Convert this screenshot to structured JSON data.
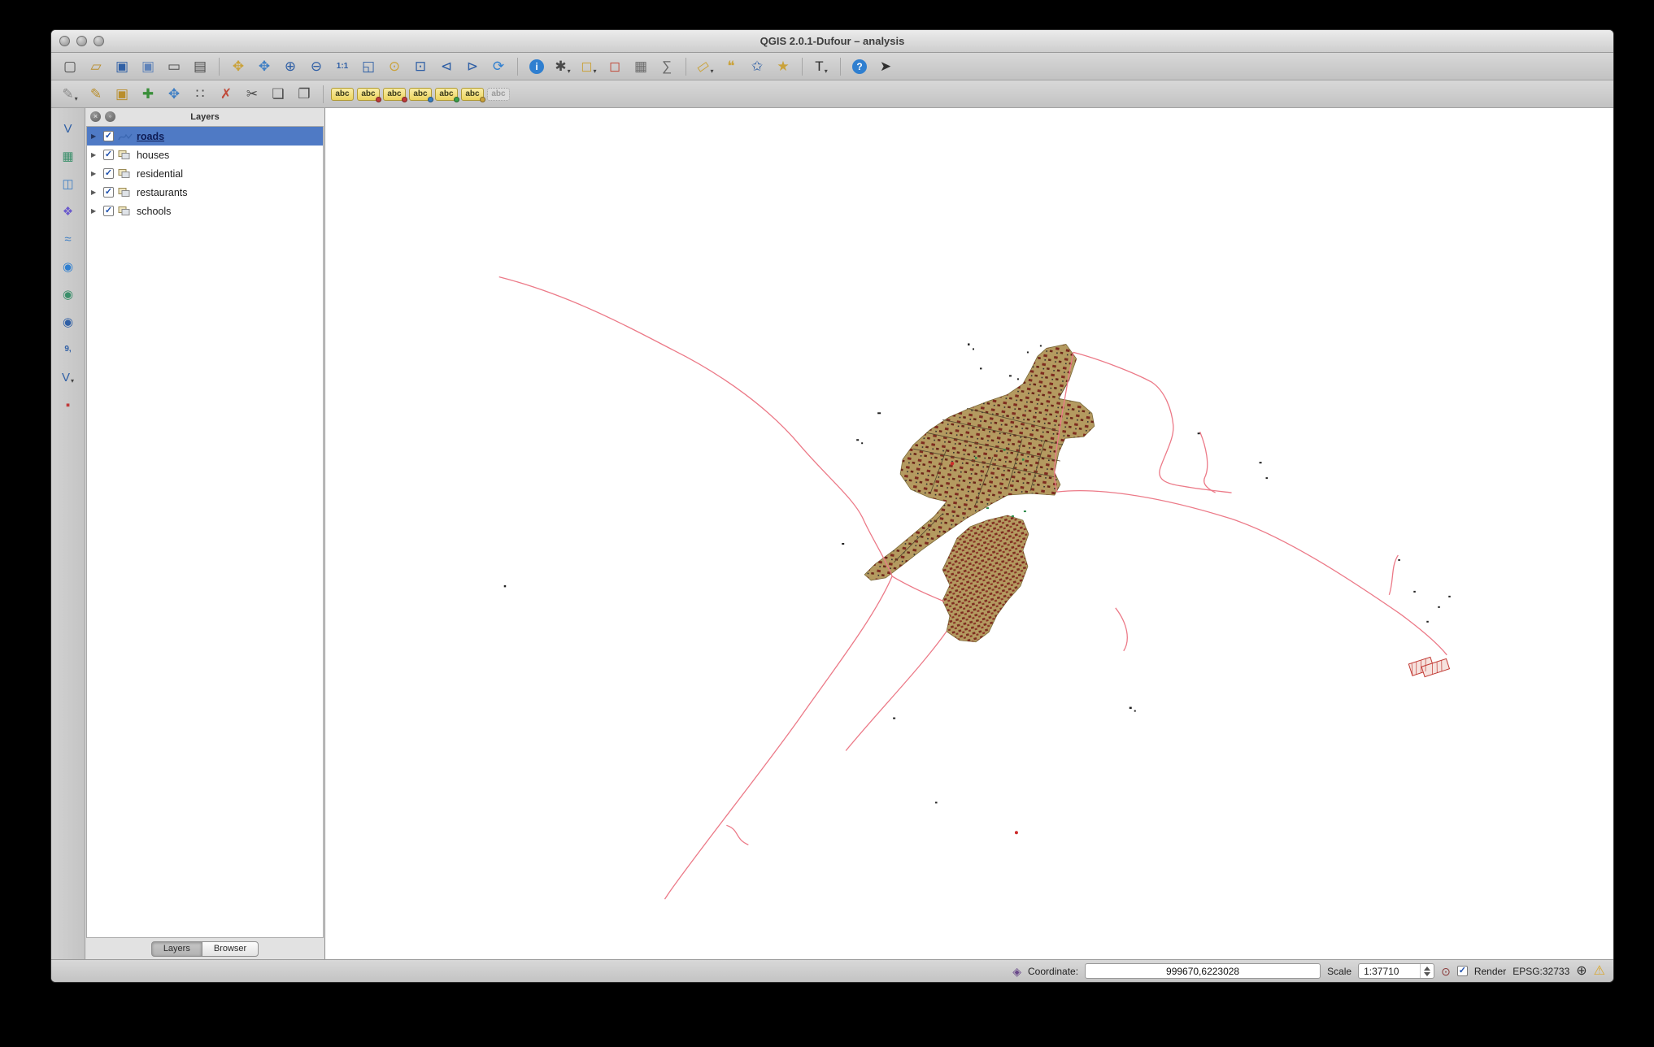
{
  "window": {
    "title": "QGIS 2.0.1-Dufour – analysis"
  },
  "misc": {
    "abc_text": "abc",
    "expand_arrow": "▶",
    "check_glyph": "✓",
    "dropdown_arrow": "▾"
  },
  "colors": {
    "road_line": "#ec7a88",
    "urban_fill": "#b49a60",
    "building": "#7d2b1f",
    "selection_blue": "#4f7ac5"
  },
  "toolbar_row1": [
    {
      "name": "new-project",
      "glyph": "▢",
      "color": "#4a4a4a"
    },
    {
      "name": "open-project",
      "glyph": "▱",
      "color": "#b98e2c"
    },
    {
      "name": "save-project",
      "glyph": "▣",
      "color": "#2f5fa5"
    },
    {
      "name": "save-project-as",
      "glyph": "▣",
      "color": "#5f83b9"
    },
    {
      "name": "new-print-composer",
      "glyph": "▭",
      "color": "#4a4a4a"
    },
    {
      "name": "composer-manager",
      "glyph": "▤",
      "color": "#4a4a4a"
    },
    {
      "sep": true
    },
    {
      "name": "pan-map",
      "glyph": "✥",
      "color": "#caa23a"
    },
    {
      "name": "pan-to-selection",
      "glyph": "✥",
      "color": "#3f7fc4"
    },
    {
      "name": "zoom-in",
      "glyph": "⊕",
      "color": "#2f5fa5"
    },
    {
      "name": "zoom-out",
      "glyph": "⊖",
      "color": "#2f5fa5"
    },
    {
      "name": "zoom-native",
      "glyph": "1:1",
      "color": "#2f5fa5",
      "small": true
    },
    {
      "name": "zoom-full",
      "glyph": "◱",
      "color": "#2f5fa5"
    },
    {
      "name": "zoom-to-selection",
      "glyph": "⊙",
      "color": "#caa23a"
    },
    {
      "name": "zoom-to-layer",
      "glyph": "⊡",
      "color": "#2f5fa5"
    },
    {
      "name": "zoom-last",
      "glyph": "⊲",
      "color": "#2f5fa5"
    },
    {
      "name": "zoom-next",
      "glyph": "⊳",
      "color": "#2f5fa5"
    },
    {
      "name": "refresh-map",
      "glyph": "⟳",
      "color": "#2f7fd0"
    },
    {
      "sep": true
    },
    {
      "name": "identify-features",
      "glyph": "i",
      "color": "#ffffff",
      "badge": "#2f7fd0"
    },
    {
      "name": "run-feature-action",
      "glyph": "✱",
      "color": "#4a4a4a",
      "dropdown": true
    },
    {
      "name": "select-features",
      "glyph": "◻",
      "color": "#caa23a",
      "dropdown": true
    },
    {
      "name": "deselect-features",
      "glyph": "◻",
      "color": "#c04a3a"
    },
    {
      "name": "open-attribute-table",
      "glyph": "▦",
      "color": "#6a6a6a"
    },
    {
      "name": "field-calculator",
      "glyph": "∑",
      "color": "#6a6a6a"
    },
    {
      "sep": true
    },
    {
      "name": "measure",
      "glyph": "▭",
      "color": "#caa23a",
      "dropdown": true,
      "rotate": true
    },
    {
      "name": "map-tips",
      "glyph": "❝",
      "color": "#caa23a"
    },
    {
      "name": "new-bookmark",
      "glyph": "✩",
      "color": "#2f5fa5"
    },
    {
      "name": "show-bookmarks",
      "glyph": "★",
      "color": "#caa23a"
    },
    {
      "sep": true
    },
    {
      "name": "text-annotation",
      "glyph": "T",
      "color": "#2f2f2f",
      "dropdown": true
    },
    {
      "sep": true
    },
    {
      "name": "help-contents",
      "glyph": "?",
      "color": "#ffffff",
      "badge": "#2f7fd0"
    },
    {
      "name": "whats-this",
      "glyph": "➤",
      "color": "#2f2f2f"
    }
  ],
  "toolbar_row2": [
    {
      "name": "current-edits",
      "glyph": "✎",
      "color": "#8a8a8a",
      "dropdown": true
    },
    {
      "name": "toggle-editing",
      "glyph": "✎",
      "color": "#b98e2c"
    },
    {
      "name": "save-layer-edits",
      "glyph": "▣",
      "color": "#b98e2c"
    },
    {
      "name": "add-feature",
      "glyph": "✚",
      "color": "#3a8f3a"
    },
    {
      "name": "move-feature",
      "glyph": "✥",
      "color": "#3f7fc4"
    },
    {
      "name": "node-tool",
      "glyph": "∷",
      "color": "#4a4a4a"
    },
    {
      "name": "delete-selected",
      "glyph": "✗",
      "color": "#c04a3a"
    },
    {
      "name": "cut-features",
      "glyph": "✂",
      "color": "#4a4a4a"
    },
    {
      "name": "copy-features",
      "glyph": "❏",
      "color": "#4a4a4a"
    },
    {
      "name": "paste-features",
      "glyph": "❐",
      "color": "#4a4a4a"
    },
    {
      "sep": true
    },
    {
      "name": "labeling",
      "abc": true,
      "accent": ""
    },
    {
      "name": "label-pin",
      "abc": true,
      "accent": "#c03a3a"
    },
    {
      "name": "label-show-hide",
      "abc": true,
      "accent": "#c03a3a"
    },
    {
      "name": "label-move",
      "abc": true,
      "accent": "#3a7fc0"
    },
    {
      "name": "label-rotate",
      "abc": true,
      "accent": "#3a9f4a"
    },
    {
      "name": "label-properties",
      "abc": true,
      "accent": "#caa23a"
    },
    {
      "name": "label-disabled",
      "abc": true,
      "disabled": true
    }
  ],
  "left_toolbar": [
    {
      "name": "add-vector-layer",
      "glyph": "V",
      "color": "#2f5fa5"
    },
    {
      "name": "add-raster-layer",
      "glyph": "▦",
      "color": "#3a8f6a"
    },
    {
      "name": "add-postgis-layer",
      "glyph": "◫",
      "color": "#3f7fc4"
    },
    {
      "name": "add-spatialite-layer",
      "glyph": "❖",
      "color": "#6a5acd"
    },
    {
      "name": "add-mssql-layer",
      "glyph": "≈",
      "color": "#3f7fc4"
    },
    {
      "name": "add-wms-layer",
      "glyph": "◉",
      "color": "#2f7fd0"
    },
    {
      "name": "add-wcs-layer",
      "glyph": "◉",
      "color": "#3a8f6a"
    },
    {
      "name": "add-wfs-layer",
      "glyph": "◉",
      "color": "#2f5fa5"
    },
    {
      "name": "add-delimited-text-layer",
      "glyph": "9,",
      "color": "#2f5fa5",
      "small": true
    },
    {
      "name": "new-shapefile-layer",
      "glyph": "V",
      "color": "#2f5fa5",
      "dropdown": true
    },
    {
      "name": "remove-layer",
      "glyph": "▪",
      "color": "#c03a3a"
    }
  ],
  "layers_panel": {
    "title": "Layers",
    "header_buttons": [
      {
        "name": "close-panel",
        "glyph": "×"
      },
      {
        "name": "detach-panel",
        "glyph": "◦"
      }
    ],
    "layers": [
      {
        "label": "roads",
        "checked": true,
        "selected": true,
        "icon": "line-symbol"
      },
      {
        "label": "houses",
        "checked": true,
        "selected": false,
        "icon": "layer-stack"
      },
      {
        "label": "residential",
        "checked": true,
        "selected": false,
        "icon": "layer-stack"
      },
      {
        "label": "restaurants",
        "checked": true,
        "selected": false,
        "icon": "layer-stack"
      },
      {
        "label": "schools",
        "checked": true,
        "selected": false,
        "icon": "layer-stack"
      }
    ],
    "tabs": [
      {
        "label": "Layers",
        "active": true
      },
      {
        "label": "Browser",
        "active": false
      }
    ]
  },
  "status_bar": {
    "tracking_glyph": "◈",
    "coordinate_label": "Coordinate:",
    "coordinate_value": "999670,6223028",
    "scale_label": "Scale",
    "scale_value": "1:37710",
    "magnifier_glyph": "⊙",
    "render_label": "Render",
    "render_checked": true,
    "crs_label": "EPSG:32733",
    "crs_icon_glyph": "⊕",
    "warning_icon_glyph": "⚠"
  }
}
